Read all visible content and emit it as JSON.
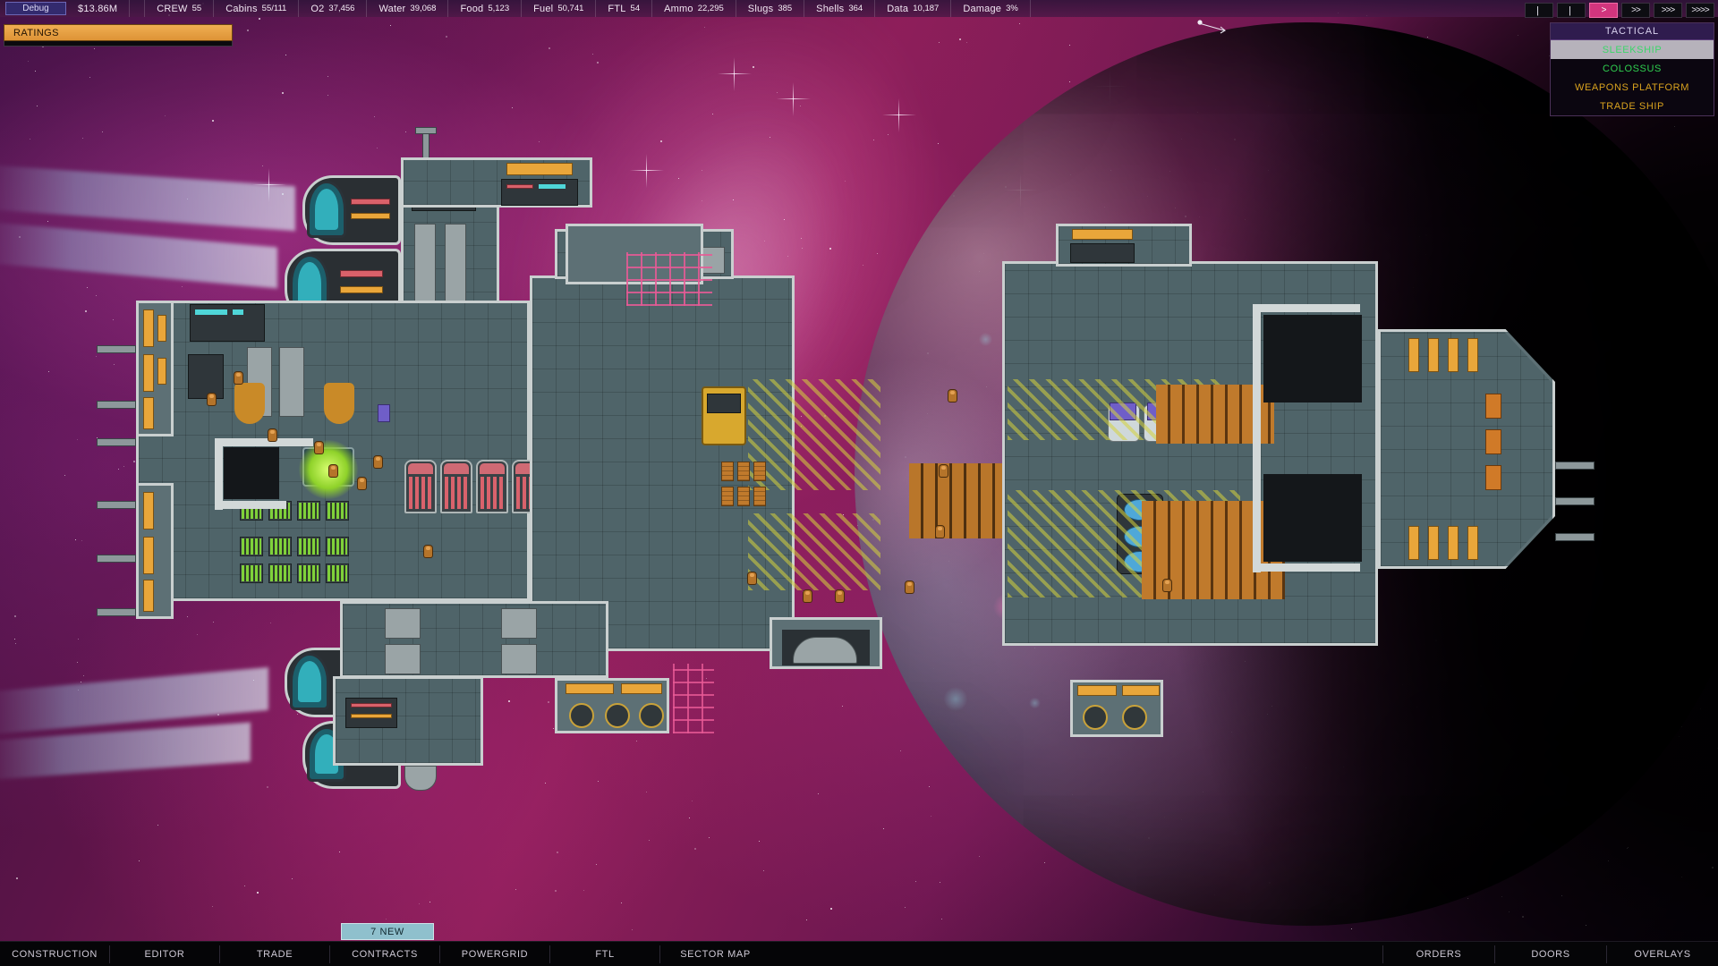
{
  "topbar": {
    "debug_label": "Debug",
    "credits": "$13.86M",
    "resources": [
      {
        "name": "crew",
        "label": "CREW",
        "value": "55"
      },
      {
        "name": "cabins",
        "label": "Cabins",
        "value": "55/111"
      },
      {
        "name": "o2",
        "label": "O2",
        "value": "37,456"
      },
      {
        "name": "water",
        "label": "Water",
        "value": "39,068"
      },
      {
        "name": "food",
        "label": "Food",
        "value": "5,123"
      },
      {
        "name": "fuel",
        "label": "Fuel",
        "value": "50,741"
      },
      {
        "name": "ftl",
        "label": "FTL",
        "value": "54"
      },
      {
        "name": "ammo",
        "label": "Ammo",
        "value": "22,295"
      },
      {
        "name": "slugs",
        "label": "Slugs",
        "value": "385"
      },
      {
        "name": "shells",
        "label": "Shells",
        "value": "364"
      },
      {
        "name": "data",
        "label": "Data",
        "value": "10,187"
      },
      {
        "name": "damage",
        "label": "Damage",
        "value": "3%"
      }
    ]
  },
  "ratings": {
    "title": "RATINGS"
  },
  "speed": {
    "buttons": [
      {
        "name": "pause-button",
        "glyph": "|",
        "active": false
      },
      {
        "name": "pause-2-button",
        "glyph": "|",
        "active": false
      },
      {
        "name": "play-button",
        "glyph": ">",
        "active": true
      },
      {
        "name": "speed-2-button",
        "glyph": ">>",
        "active": false
      },
      {
        "name": "speed-3-button",
        "glyph": ">>>",
        "active": false
      },
      {
        "name": "speed-4-button",
        "glyph": ">>>>",
        "active": false
      }
    ]
  },
  "tactical": {
    "header": "TACTICAL",
    "ships": [
      {
        "name": "sleekship",
        "label": "SLEEKSHIP",
        "selected": true,
        "color": "#3cd66a"
      },
      {
        "name": "colossus",
        "label": "COLOSSUS",
        "selected": false,
        "color": "#2fcf4f"
      },
      {
        "name": "weapons-platform",
        "label": "WEAPONS PLATFORM",
        "selected": false,
        "color": "#d9a21e"
      },
      {
        "name": "trade-ship",
        "label": "TRADE SHIP",
        "selected": false,
        "color": "#d9a21e"
      }
    ]
  },
  "notification": {
    "new_label": "7 NEW"
  },
  "bottombar": {
    "left_items": [
      {
        "name": "construction",
        "label": "CONSTRUCTION"
      },
      {
        "name": "editor",
        "label": "EDITOR"
      },
      {
        "name": "trade",
        "label": "TRADE"
      },
      {
        "name": "contracts",
        "label": "CONTRACTS"
      },
      {
        "name": "powergrid",
        "label": "POWERGRID"
      },
      {
        "name": "ftl",
        "label": "FTL"
      },
      {
        "name": "sector-map",
        "label": "SECTOR MAP"
      }
    ],
    "right_items": [
      {
        "name": "orders",
        "label": "ORDERS"
      },
      {
        "name": "doors",
        "label": "DOORS"
      },
      {
        "name": "overlays",
        "label": "OVERLAYS"
      }
    ]
  },
  "colors": {
    "accent_pink": "#d2357e",
    "hull_wall": "#c9cfcf",
    "deck_floor": "#4f6469",
    "amber_module": "#e9a63a",
    "nebula_magenta": "#8e1f59",
    "tactical_header": "#2f1c4e"
  }
}
